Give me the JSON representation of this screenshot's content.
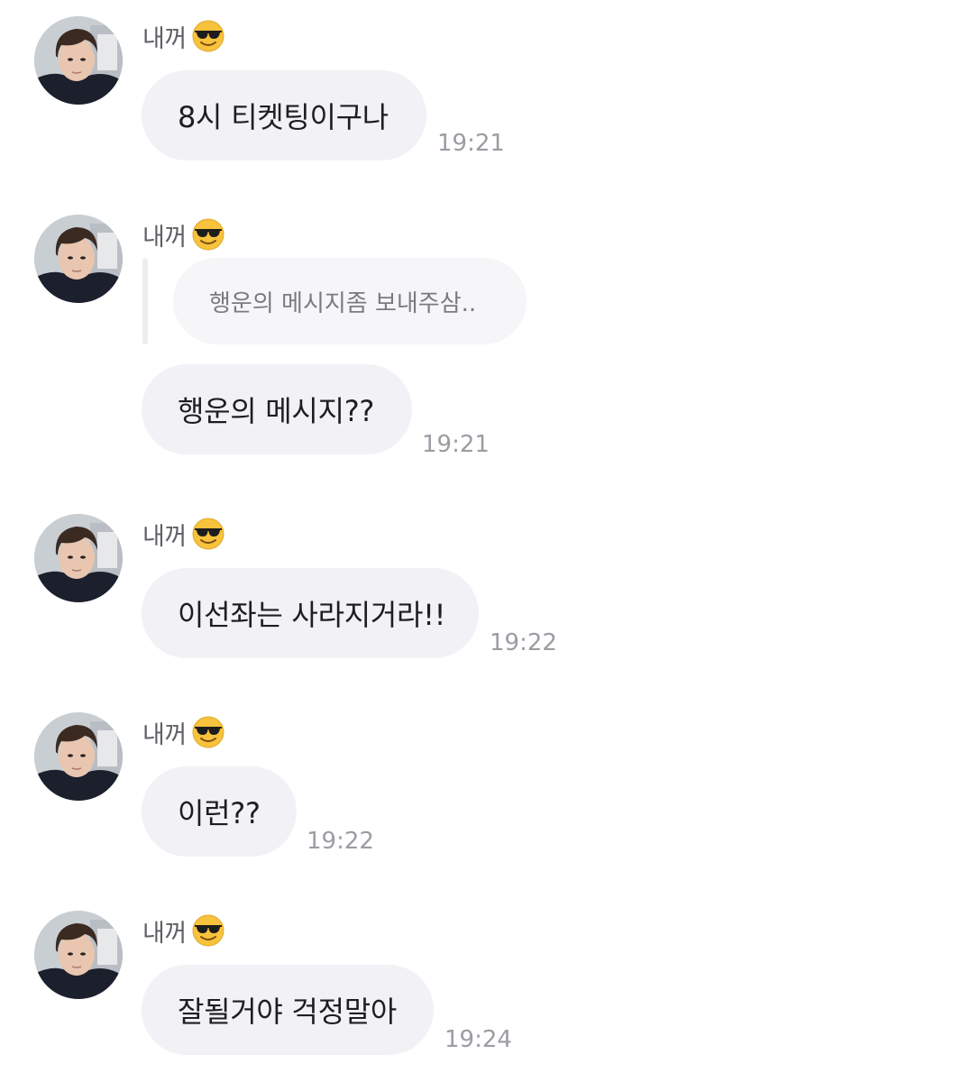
{
  "chat": {
    "messages": [
      {
        "sender": "내꺼",
        "sender_emoji": "smiling-face-with-sunglasses",
        "text": "8시 티켓팅이구나",
        "time": "19:21"
      },
      {
        "sender": "내꺼",
        "sender_emoji": "smiling-face-with-sunglasses",
        "quoted_reply": "행운의 메시지좀 보내주삼..",
        "text": "행운의 메시지??",
        "time": "19:21"
      },
      {
        "sender": "내꺼",
        "sender_emoji": "smiling-face-with-sunglasses",
        "text": "이선좌는 사라지거라!!",
        "time": "19:22"
      },
      {
        "sender": "내꺼",
        "sender_emoji": "smiling-face-with-sunglasses",
        "text": "이런??",
        "time": "19:22"
      },
      {
        "sender": "내꺼",
        "sender_emoji": "smiling-face-with-sunglasses",
        "text": "잘될거야 걱정말아",
        "time": "19:24"
      }
    ]
  },
  "colors": {
    "background": "#ffffff",
    "bubble": "#f2f2f6",
    "quote_bubble": "#f6f6f9",
    "text": "#1e1e22",
    "timestamp": "#9c9ca4",
    "sender_name": "#5f5f66"
  }
}
